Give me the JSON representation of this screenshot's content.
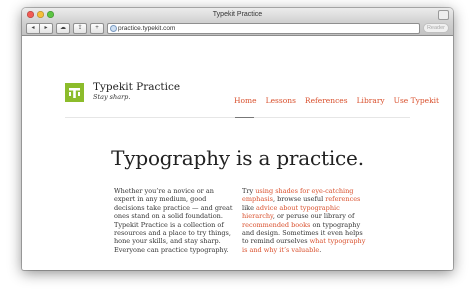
{
  "window": {
    "title": "Typekit Practice"
  },
  "toolbar": {
    "back_label": "◂",
    "forward_label": "▸",
    "url": "practice.typekit.com",
    "add_label": "+",
    "reader_label": "Reader"
  },
  "site": {
    "brand": "Typekit Practice",
    "tagline": "Stay sharp.",
    "logo_color": "#8cbc2b",
    "accent_color": "#d9502d"
  },
  "nav": {
    "items": [
      "Home",
      "Lessons",
      "References",
      "Library",
      "Use Typekit"
    ],
    "active": "Home"
  },
  "headline": "Typography is a practice.",
  "left_column": "Whether you’re a novice or an expert in any medium, good decisions take practice — and great ones stand on a solid foundation. Typekit Practice is a collection of resources and a place to try things, hone your skills, and stay sharp. Everyone can practice typography.",
  "right_column": {
    "t1": "Try ",
    "l1": "using shades for eye-catching emphasis",
    "t2": ", browse useful ",
    "l2": "references",
    "t3": " like ",
    "l3": "advice about typographic hierarchy",
    "t4": ", or peruse our library of ",
    "l4": "recommended books",
    "t5": " on typography and design. Sometimes it even helps to remind ourselves ",
    "l5": "what typography is and why it’s valuable",
    "t6": "."
  }
}
